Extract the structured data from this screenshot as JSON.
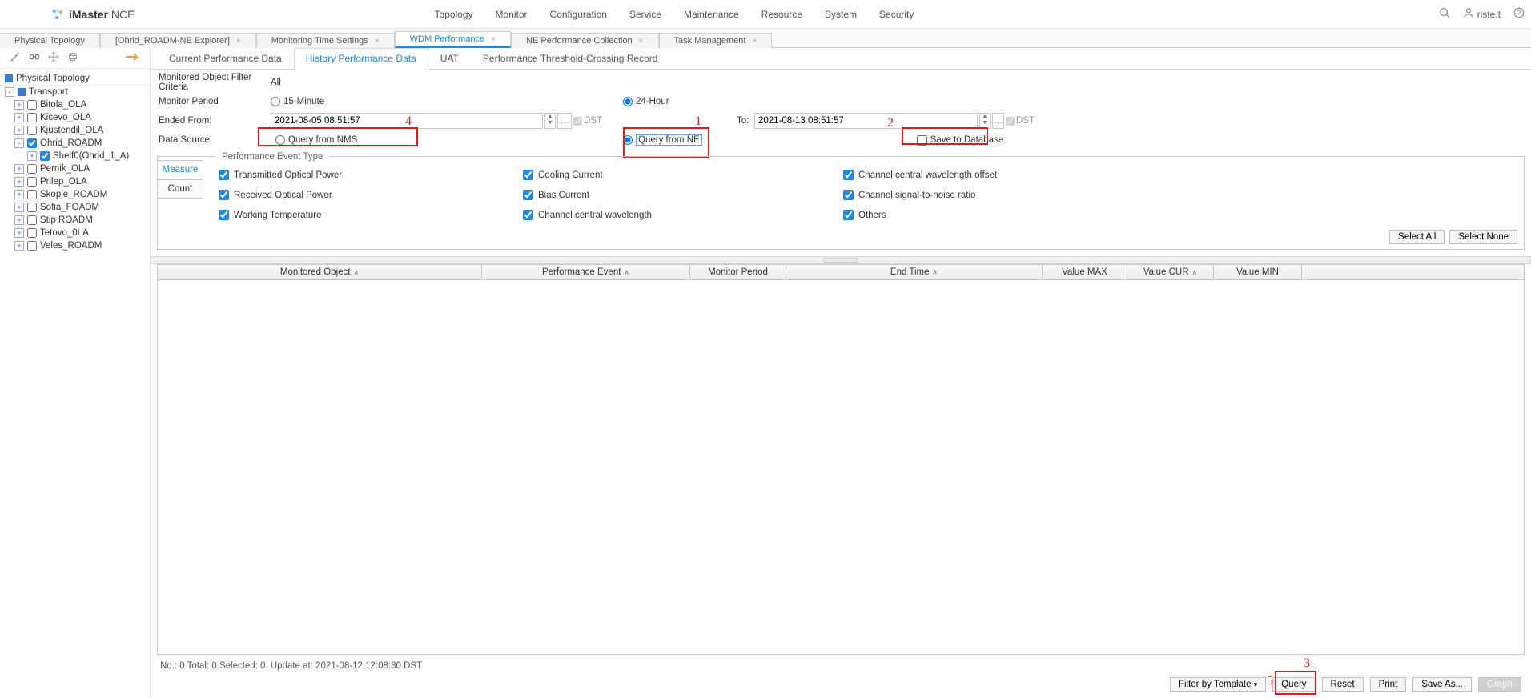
{
  "header": {
    "product_bold": "iMaster",
    "product_light": "NCE",
    "nav": [
      "Topology",
      "Monitor",
      "Configuration",
      "Service",
      "Maintenance",
      "Resource",
      "System",
      "Security"
    ],
    "user": "riste.t"
  },
  "doc_tabs": [
    {
      "label": "Physical Topology",
      "closable": false
    },
    {
      "label": "[Ohrid_ROADM-NE Explorer]",
      "closable": true
    },
    {
      "label": "Monitoring Time Settings",
      "closable": true
    },
    {
      "label": "WDM Performance",
      "closable": true,
      "active": true
    },
    {
      "label": "NE Performance Collection",
      "closable": true
    },
    {
      "label": "Task Management",
      "closable": true
    }
  ],
  "tree": {
    "root": "Physical Topology",
    "branch": "Transport",
    "nodes": [
      {
        "label": "Bitola_OLA",
        "expand": "+"
      },
      {
        "label": "Kicevo_OLA",
        "expand": "+"
      },
      {
        "label": "Kjustendil_OLA",
        "expand": "+"
      },
      {
        "label": "Ohrid_ROADM",
        "expand": "-",
        "checked": true,
        "children": [
          {
            "label": "Shelf0(Ohrid_1_A)",
            "expand": "+",
            "checked": true
          }
        ]
      },
      {
        "label": "Pernik_OLA",
        "expand": "+"
      },
      {
        "label": "Prilep_OLA",
        "expand": "+"
      },
      {
        "label": "Skopje_ROADM",
        "expand": "+"
      },
      {
        "label": "Sofia_FOADM",
        "expand": "+"
      },
      {
        "label": "Stip ROADM",
        "expand": "+"
      },
      {
        "label": "Tetovo_0LA",
        "expand": "+"
      },
      {
        "label": "Veles_ROADM",
        "expand": "+"
      }
    ]
  },
  "subtabs": [
    "Current Performance Data",
    "History Performance Data",
    "UAT",
    "Performance Threshold-Crossing Record"
  ],
  "subtabs_active": 1,
  "filter": {
    "criteria_label": "Monitored Object Filter Criteria",
    "criteria_value": "All",
    "period_label": "Monitor Period",
    "period_opts": [
      "15-Minute",
      "24-Hour"
    ],
    "period_selected": 1,
    "from_label": "Ended From:",
    "from_value": "2021-08-05 08:51:57",
    "to_label": "To:",
    "to_value": "2021-08-13 08:51:57",
    "dst": "DST",
    "source_label": "Data Source",
    "source_opts": [
      "Query from NMS",
      "Query from NE"
    ],
    "source_selected": 1,
    "save_db": "Save to Database"
  },
  "annotations": {
    "a1": "1",
    "a2": "2",
    "a3": "3",
    "a4": "4",
    "a5": "5"
  },
  "event": {
    "legend": "Performance Event Type",
    "side_tabs": [
      "Measure",
      "Count"
    ],
    "items": [
      "Transmitted Optical Power",
      "Cooling Current",
      "Channel central wavelength offset",
      "Received Optical Power",
      "Bias Current",
      "Channel signal-to-noise ratio",
      "Working Temperature",
      "Channel central wavelength",
      "Others"
    ],
    "select_all": "Select All",
    "select_none": "Select None"
  },
  "grid": {
    "cols": [
      "Monitored Object",
      "Performance Event",
      "Monitor Period",
      "End Time",
      "Value MAX",
      "Value CUR",
      "Value MIN"
    ]
  },
  "status": "No.: 0  Total: 0  Selected: 0. Update at: 2021-08-12 12:08:30 DST",
  "buttons": {
    "filter_tpl": "Filter by Template",
    "query": "Query",
    "reset": "Reset",
    "print": "Print",
    "save_as": "Save As...",
    "graph": "Graph"
  }
}
